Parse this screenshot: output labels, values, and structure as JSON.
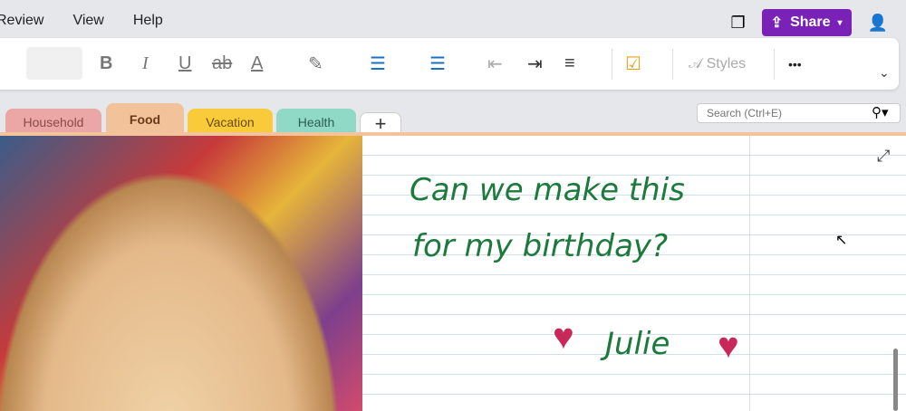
{
  "menu": [
    "Review",
    "View",
    "Help"
  ],
  "share": {
    "label": "Share"
  },
  "ribbon": {
    "bold": "B",
    "italic": "I",
    "underline": "U",
    "strike": "ab",
    "font_color": "A",
    "styles": "Styles",
    "more": "•••"
  },
  "tabs": [
    {
      "label": "Household",
      "color": "#eba6a6",
      "text": "#8a4a4a"
    },
    {
      "label": "Food",
      "color": "#f2c39a",
      "text": "#6b3a1a"
    },
    {
      "label": "Vacation",
      "color": "#f9cb3b",
      "text": "#6b4a00"
    },
    {
      "label": "Health",
      "color": "#8fd9c6",
      "text": "#2e5d55"
    }
  ],
  "add_tab": "+",
  "search": {
    "placeholder": "Search (Ctrl+E)"
  },
  "note": {
    "line1": "Can we make this",
    "line2": "for my birthday?",
    "signature": "Julie"
  }
}
